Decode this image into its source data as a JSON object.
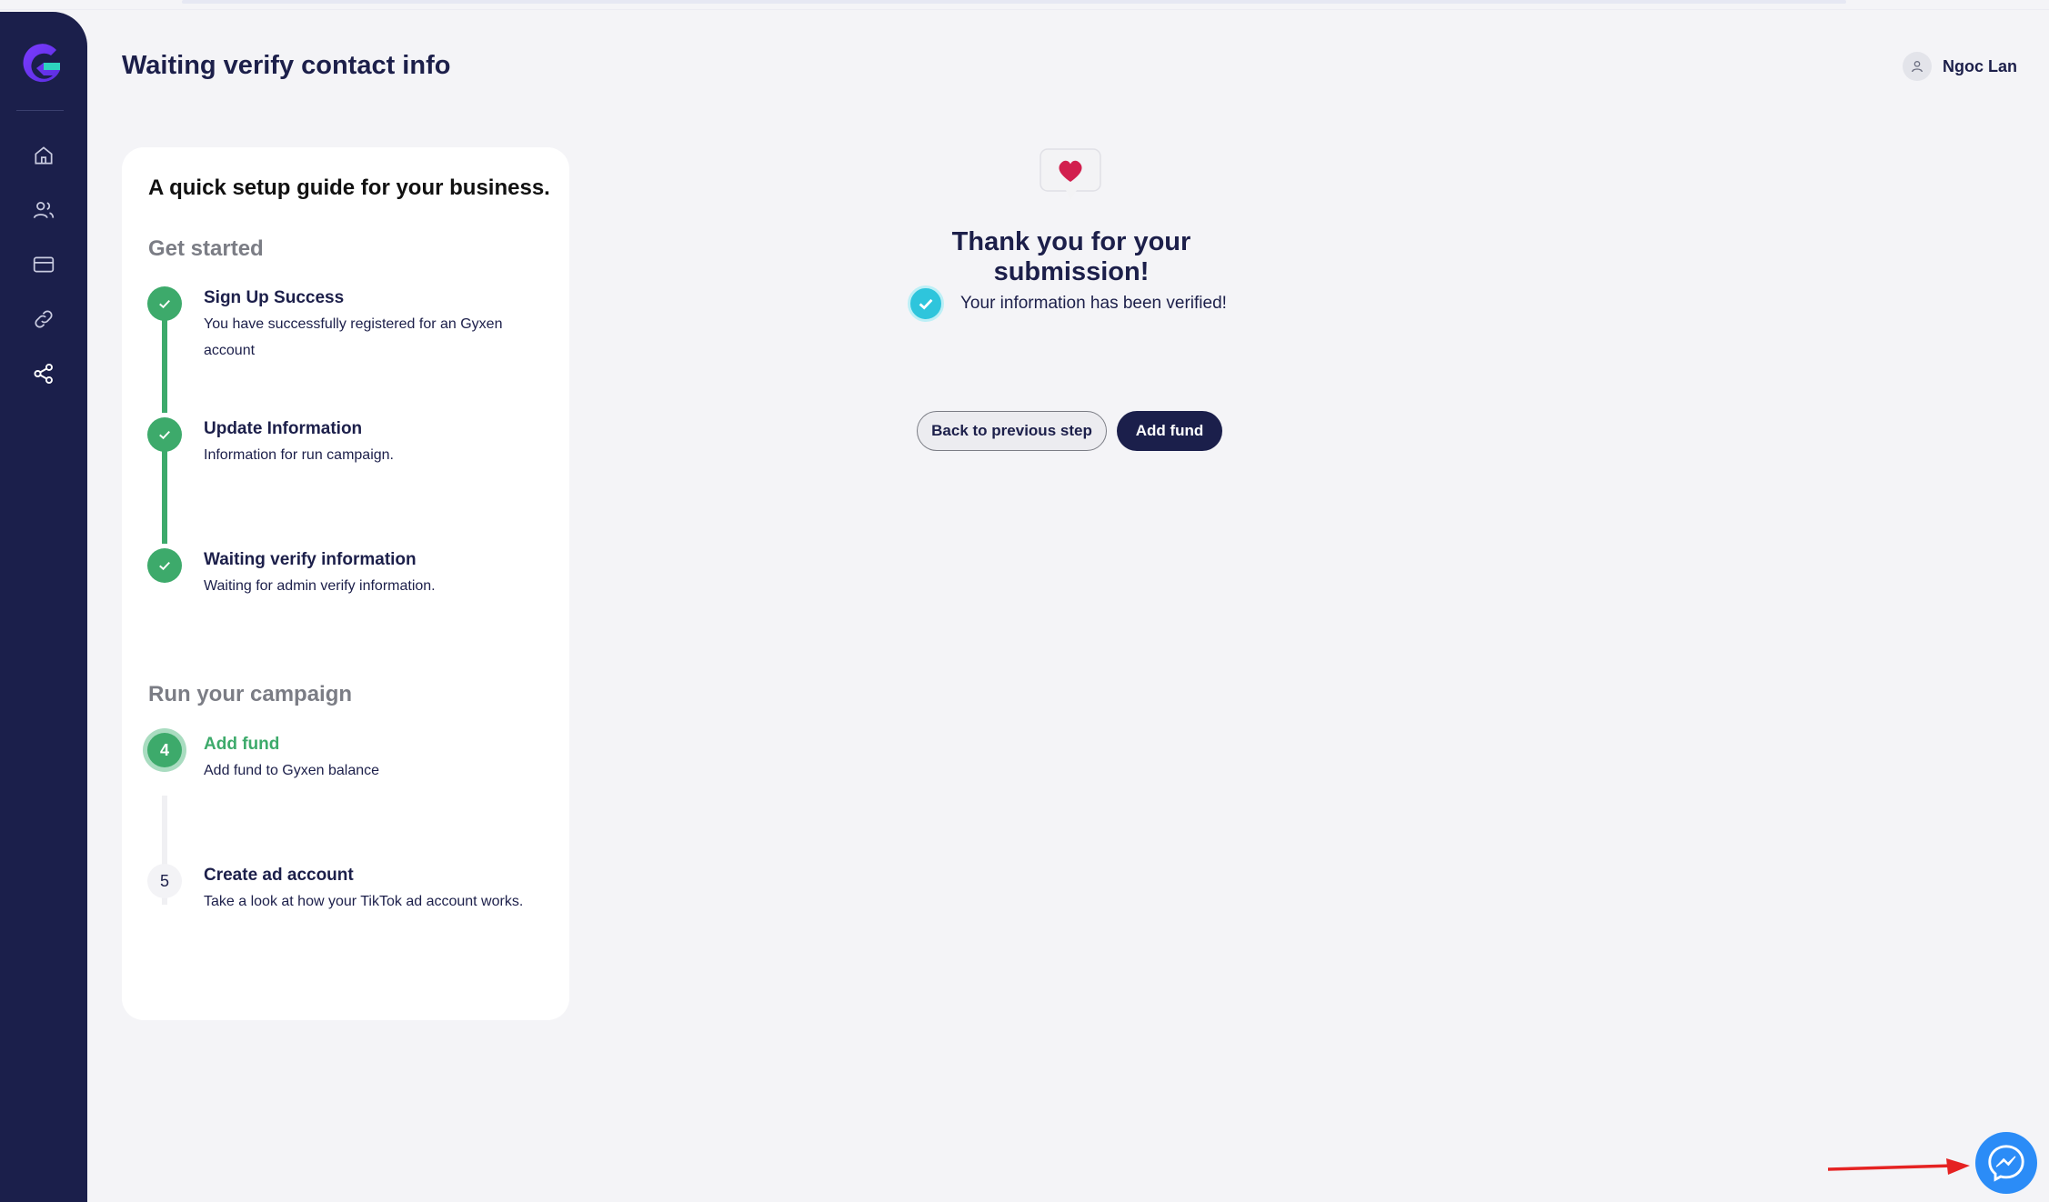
{
  "header": {
    "title": "Waiting verify contact info",
    "user_name": "Ngoc Lan"
  },
  "sidebar": {
    "items": [
      {
        "name": "home",
        "icon": "home-icon"
      },
      {
        "name": "users",
        "icon": "users-icon"
      },
      {
        "name": "billing",
        "icon": "credit-card-icon"
      },
      {
        "name": "links",
        "icon": "link-icon"
      },
      {
        "name": "share",
        "icon": "share-icon"
      }
    ]
  },
  "guide": {
    "title": "A quick setup guide for your business.",
    "section_get_started": "Get started",
    "section_run_campaign": "Run your campaign",
    "steps": [
      {
        "number": "1",
        "status": "done",
        "title": "Sign Up Success",
        "description": "You have successfully registered for an Gyxen account"
      },
      {
        "number": "2",
        "status": "done",
        "title": "Update Information",
        "description": "Information for run campaign."
      },
      {
        "number": "3",
        "status": "done",
        "title": "Waiting verify information",
        "description": "Waiting for admin verify information."
      },
      {
        "number": "4",
        "status": "active",
        "title": "Add fund",
        "description": "Add fund to Gyxen balance"
      },
      {
        "number": "5",
        "status": "pending",
        "title": "Create ad account",
        "description": "Take a look at how your TikTok ad account works."
      }
    ]
  },
  "main": {
    "thanks_title": "Thank you for your submission!",
    "verified_text": "Your information has been verified!",
    "back_button": "Back to previous step",
    "add_fund_button": "Add fund"
  },
  "colors": {
    "sidebar_bg": "#1b1f4b",
    "accent_green": "#3daa6b",
    "verified_cyan": "#2ec5dc",
    "messenger_blue": "#2b8cf7"
  }
}
